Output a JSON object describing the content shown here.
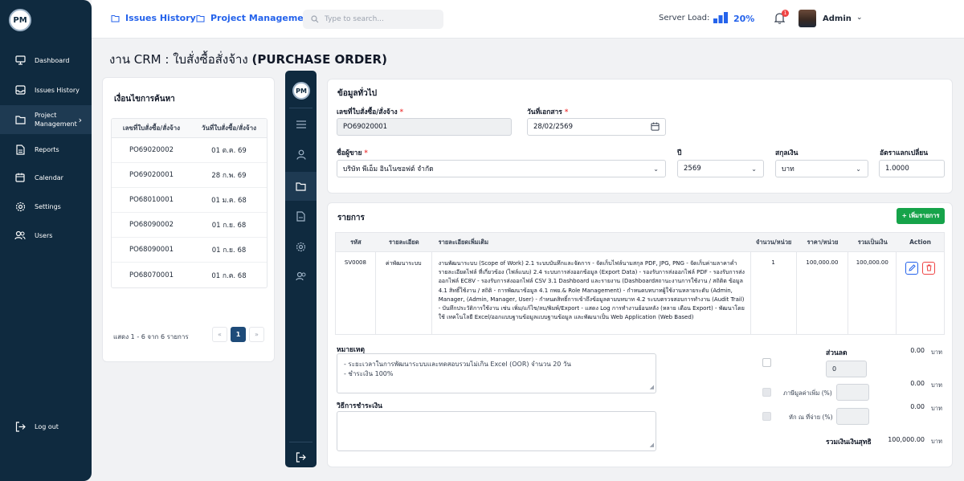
{
  "logo": "PM",
  "sidebar": {
    "items": [
      {
        "label": "Dashboard",
        "icon": "monitor-icon"
      },
      {
        "label": "Issues History",
        "icon": "inbox-icon"
      },
      {
        "label_1": "Project",
        "label_2": "Management",
        "icon": "folder-icon"
      },
      {
        "label": "Reports",
        "icon": "document-icon"
      },
      {
        "label": "Calendar",
        "icon": "calendar-icon"
      },
      {
        "label": "Settings",
        "icon": "gear-icon"
      },
      {
        "label": "Users",
        "icon": "users-icon"
      }
    ],
    "logout": "Log out"
  },
  "topbar": {
    "crumb_1": "Issues History",
    "crumb_2": "Project Management",
    "search_placeholder": "Type to search...",
    "server_label": "Server Load:",
    "server_value": "20%",
    "notif_count": "1",
    "user": "Admin"
  },
  "page_title": {
    "prefix": "งาน CRM : ใบสั่งซื้อสั่งจ้าง",
    "suffix": "(PURCHASE ORDER)"
  },
  "search_panel": {
    "title": "เงื่อนไขการค้นหา",
    "col_1": "เลขที่ใบสั่งซื้อ/สั่งจ้าง",
    "col_2": "วันที่ใบสั่งซื้อ/สั่งจ้าง",
    "rows": [
      {
        "no": "PO69020002",
        "date": "01 ต.ค. 69"
      },
      {
        "no": "PO69020001",
        "date": "28 ก.พ. 69"
      },
      {
        "no": "PO68010001",
        "date": "01 ม.ค. 68"
      },
      {
        "no": "PO68090002",
        "date": "01 ก.ย. 68"
      },
      {
        "no": "PO68090001",
        "date": "01 ก.ย. 68"
      },
      {
        "no": "PO68070001",
        "date": "01 ก.ค. 68"
      }
    ],
    "summary": "แสดง 1 - 6 จาก 6 รายการ",
    "prev": "«",
    "page": "1",
    "next": "»"
  },
  "general": {
    "title": "ข้อมูลทั่วไป",
    "po_label": "เลขที่ใบสั่งซื้อ/สั่งจ้าง",
    "po_value": "PO69020001",
    "date_label": "วันที่เอกสาร",
    "date_value": "28/02/2569",
    "vendor_label": "ชื่อผู้ขาย",
    "vendor_value": "บริษัท พีเอ็ม อินโนซอฟต์ จำกัด",
    "year_label": "ปี",
    "year_value": "2569",
    "currency_label": "สกุลเงิน",
    "currency_value": "บาท",
    "rate_label": "อัตราแลกเปลี่ยน",
    "rate_value": "1.0000",
    "req_mark": "*"
  },
  "items": {
    "title": "รายการ",
    "add_label": "+ เพิ่มรายการ",
    "headers": {
      "code": "รหัส",
      "detail": "รายละเอียด",
      "extra": "รายละเอียดเพิ่มเติม",
      "qty": "จำนวน/หน่วย",
      "price": "ราคา/หน่วย",
      "total": "รวมเป็นเงิน",
      "action": "Action"
    },
    "row": {
      "code": "SV0008",
      "detail": "ค่าพัฒนาระบบ",
      "extra": "งานพัฒนาระบบ (Scope of Work) 2.1 ระบบบันทึกและจัดการ - จัดเก็บไฟล์นามสกุล PDF, JPG, PNG - จัดเก็บค่ามลาคาค่ำ รายละเอียดไฟล์ ที่เกี่ยวข้อง (ไฟล์แนบ) 2.4 ระบบการส่งออกข้อมูล (Export Data) - รองรับการส่งออกไฟล์ PDF - รองรับการส่งออกไฟล์ EC8V - รองรับการส่งออกไฟล์ CSV 3.1 Dashboard และรายงาน (Dashboardสถานะงานการใช้งาน / สถิติต ข้อมูล 4.1 สิทธิ์ใช้งาน / สถิติ - การพัฒนาข้อมูล 4.1 กพย.& Role Management) - กำหนดบทบาทผู้ใช้งานหลายระดับ (Admin, Manager, (Admin, Manager, User) - กำหนดสิทธิ์การเข้าถึงข้อมูลตามบทบาท 4.2 ระบบตรวจสอบการทำงาน (Audit Trail) - บันทึกประวัติการใช้งาน เช่น เพิ่ม/แก้ไข/ลบ/พิมพ์/Export - แสดง Log การทำงานย้อนหลัง (หลาย เดือน Export) - พัฒนาโดยใช้ เทคโนโลยี Excel/ออกแบบฐานข้อมูลแบบฐานข้อมูล และพัฒนาเป็น Web Application (Web Based)",
      "qty": "1",
      "price": "100,000.00",
      "total": "100,000.00"
    }
  },
  "notes": {
    "label": "หมายเหตุ",
    "line_1": "- ระยะเวลาในการพัฒนาระบบและทดสอบรวมไม่เกิน Excel (OOR) จำนวน 20 วัน",
    "line_2": "- ชำระเงิน 100%"
  },
  "payment": {
    "label": "วิธีการชำระเงิน"
  },
  "summary": {
    "discount_label": "ส่วนลด",
    "discount_amount": "0.00",
    "discount_input": "0",
    "vat_label": "ภาษีมูลค่าเพิ่ม (%)",
    "vat_amount": "0.00",
    "wht_label": "หัก ณ ที่จ่าย (%)",
    "wht_amount": "0.00",
    "net_label": "รวมเงินเงินสุทธิ",
    "net_amount": "100,000.00",
    "unit": "บาท"
  },
  "colors": {
    "primary": "#0f2a3f",
    "accent": "#2563eb",
    "success": "#16a34a",
    "danger": "#ef4444"
  }
}
